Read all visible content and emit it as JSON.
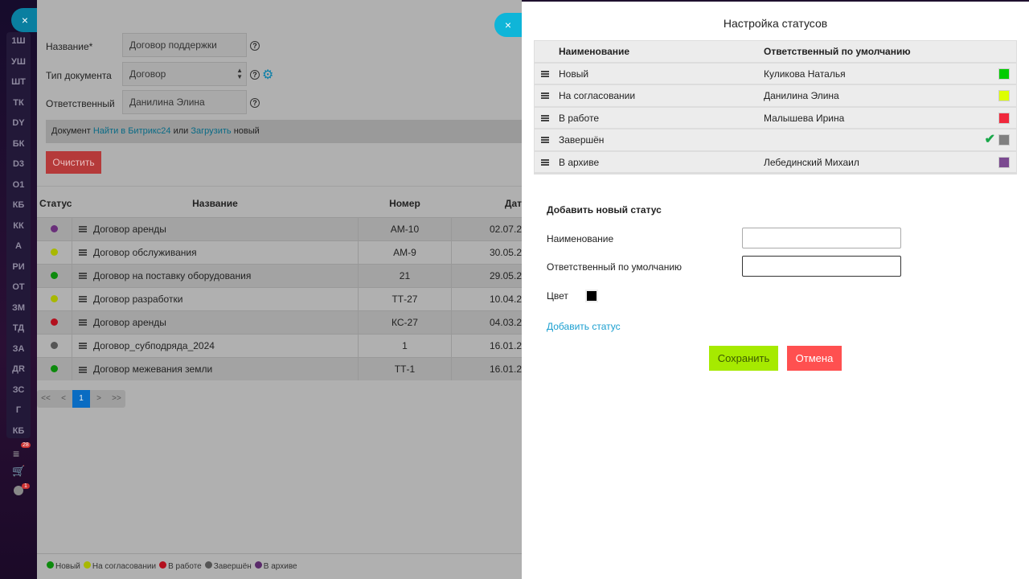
{
  "sidebar": {
    "items": [
      "1Ш",
      "УШ",
      "ШТ",
      "ТК",
      "DY",
      "БК",
      "D3",
      "O1",
      "КБ",
      "КК",
      "А",
      "РИ",
      "ОТ",
      "ЗМ",
      "ТД",
      "ЗА",
      "ДR",
      "ЗС",
      "Г",
      "КБ"
    ],
    "filter_badge": "28",
    "check_badge": "1"
  },
  "form": {
    "name_label": "Название*",
    "name_value": "Договор поддержки",
    "type_label": "Тип документа",
    "type_value": "Договор",
    "resp_label": "Ответственный",
    "resp_value": "Данилина Элина",
    "help": "?",
    "doc_prefix": "Документ",
    "doc_find": "Найти в Битрикс24",
    "doc_or": "или",
    "doc_upload": "Загрузить",
    "doc_suffix": "новый",
    "clear_button": "Очистить"
  },
  "table": {
    "headers": [
      "Статус",
      "Название",
      "Номер",
      "Дат"
    ],
    "rows": [
      {
        "color": "#6a2f7a",
        "name": "Договор аренды",
        "number": "АМ-10",
        "date": "02.07.2"
      },
      {
        "color": "#a8b800",
        "name": "Договор обслуживания",
        "number": "АМ-9",
        "date": "30.05.2"
      },
      {
        "color": "#0d8a0d",
        "name": "Договор на поставку оборудования",
        "number": "21",
        "date": "29.05.2"
      },
      {
        "color": "#a8b800",
        "name": "Договор разработки",
        "number": "ТТ-27",
        "date": "10.04.2"
      },
      {
        "color": "#b3101e",
        "name": "Договор аренды",
        "number": "КС-27",
        "date": "04.03.2"
      },
      {
        "color": "#555555",
        "name": "Договор_субподряда_2024",
        "number": "1",
        "date": "16.01.2"
      },
      {
        "color": "#0d8a0d",
        "name": "Договор межевания земли",
        "number": "ТТ-1",
        "date": "16.01.2"
      }
    ]
  },
  "pager": {
    "first": "<<",
    "prev": "<",
    "current": "1",
    "next": ">",
    "last": ">>"
  },
  "legend": [
    {
      "label": "Новый",
      "color": "#0d8a0d"
    },
    {
      "label": "На согласовании",
      "color": "#a8b800"
    },
    {
      "label": "В работе",
      "color": "#b3101e"
    },
    {
      "label": "Завершён",
      "color": "#555555"
    },
    {
      "label": "В архиве",
      "color": "#5a2a6a"
    }
  ],
  "modal": {
    "title": "Настройка статусов",
    "col_name": "Наименование",
    "col_resp": "Ответственный по умолчанию",
    "statuses": [
      {
        "name": "Новый",
        "resp": "Куликова Наталья",
        "color": "#00cc00",
        "default": false
      },
      {
        "name": "На согласовании",
        "resp": "Данилина Элина",
        "color": "#ddff00",
        "default": false
      },
      {
        "name": "В работе",
        "resp": "Малышева Ирина",
        "color": "#f0283c",
        "default": false
      },
      {
        "name": "Завершён",
        "resp": "",
        "color": "#808080",
        "default": true
      },
      {
        "name": "В архиве",
        "resp": "Лебединский Михаил",
        "color": "#7b4a90",
        "default": false
      }
    ],
    "add_title": "Добавить новый статус",
    "f_name": "Наименование",
    "f_resp": "Ответственный по умолчанию",
    "f_color": "Цвет",
    "f_color_value": "#000000",
    "add_link": "Добавить статус",
    "save": "Сохранить",
    "cancel": "Отмена"
  }
}
